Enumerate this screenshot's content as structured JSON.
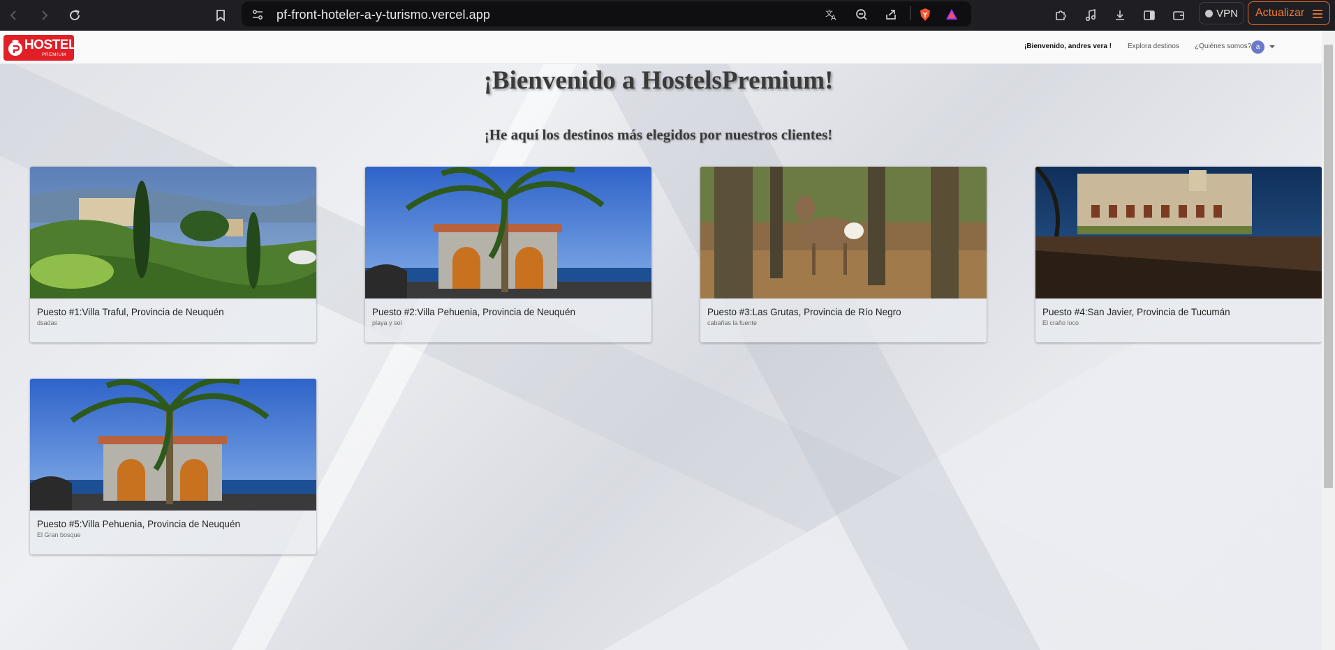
{
  "browser": {
    "url": "pf-front-hoteler-a-y-turismo.vercel.app",
    "vpn_label": "VPN",
    "update_label": "Actualizar"
  },
  "site": {
    "logo_text": "HOSTEL",
    "logo_sub": "PREMIUM",
    "nav": {
      "welcome": "¡Bienvenido, andres vera !",
      "explore": "Explora destinos",
      "about": "¿Quiénes somos?",
      "avatar_letter": "a"
    }
  },
  "hero": {
    "title": "¡Bienvenido a HostelsPremium!",
    "subtitle": "¡He aquí los destinos más elegidos por nuestros clientes!"
  },
  "destinations": [
    {
      "title": "Puesto #1:Villa Traful, Provincia de Neuquén",
      "description": "dsadas",
      "image": "italian-villa-garden"
    },
    {
      "title": "Puesto #2:Villa Pehuenia, Provincia de Neuquén",
      "description": "playa y sol",
      "image": "palm-house-sea"
    },
    {
      "title": "Puesto #3:Las Grutas, Provincia de Río Negro",
      "description": "cabañas la fuente",
      "image": "deer-forest"
    },
    {
      "title": "Puesto #4:San Javier, Provincia de Tucumán",
      "description": "El craño loco",
      "image": "abandoned-hotel-graffiti"
    },
    {
      "title": "Puesto #5:Villa Pehuenia, Provincia de Neuquén",
      "description": "El Gran bosque",
      "image": "palm-house-sea"
    }
  ],
  "colors": {
    "logo_red": "#e11f26",
    "update_orange": "#ee6a2b",
    "avatar": "#6b79c9"
  }
}
